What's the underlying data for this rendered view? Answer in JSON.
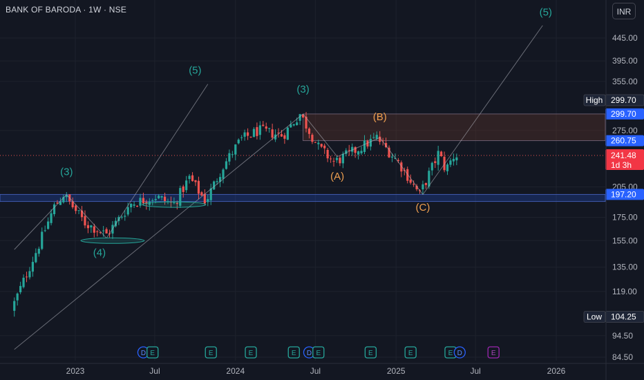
{
  "header": {
    "title": "BANK OF BARODA · 1W · NSE",
    "currency": "INR"
  },
  "colors": {
    "background": "#131722",
    "up": "#26a69a",
    "down": "#ef5350",
    "wave_teal": "#26a69a",
    "wave_orange": "#f0a050",
    "zone_blue": "#2962ff",
    "zone_brown": "#6d3a2a",
    "price_tag_red": "#f23645",
    "high_tag_blue": "#2962ff"
  },
  "chart_data": {
    "type": "candlestick",
    "title": "BANK OF BARODA · 1W · NSE",
    "x_axis": {
      "tick_labels": [
        "2023",
        "Jul",
        "2024",
        "Jul",
        "2025",
        "Jul",
        "2026"
      ]
    },
    "y_axis": {
      "scale": "log",
      "tick_labels": [
        "445.00",
        "395.00",
        "355.00",
        "275.00",
        "205.00",
        "175.00",
        "155.00",
        "135.00",
        "119.00",
        "94.50",
        "84.50"
      ],
      "range": [
        80,
        520
      ]
    },
    "price_tags": {
      "high_label": "High",
      "high_value": "299.70",
      "zone_top": "299.70",
      "zone_mid": "260.75",
      "last_price": "241.48",
      "countdown": "1d 3h",
      "zone_low": "197.20",
      "low_label": "Low",
      "low_value": "104.25"
    },
    "price_path": [
      {
        "date": "2022-08-15",
        "price": 108
      },
      {
        "date": "2022-10-15",
        "price": 150
      },
      {
        "date": "2022-11-21",
        "price": 185
      },
      {
        "date": "2022-12-12",
        "price": 197
      },
      {
        "date": "2023-01-30",
        "price": 170
      },
      {
        "date": "2023-03-20",
        "price": 160
      },
      {
        "date": "2023-05-15",
        "price": 188
      },
      {
        "date": "2023-07-10",
        "price": 195
      },
      {
        "date": "2023-08-20",
        "price": 187
      },
      {
        "date": "2023-09-25",
        "price": 215
      },
      {
        "date": "2023-11-01",
        "price": 190
      },
      {
        "date": "2023-12-10",
        "price": 228
      },
      {
        "date": "2024-01-20",
        "price": 262
      },
      {
        "date": "2024-03-01",
        "price": 275
      },
      {
        "date": "2024-04-25",
        "price": 268
      },
      {
        "date": "2024-06-03",
        "price": 299.7
      },
      {
        "date": "2024-07-15",
        "price": 252
      },
      {
        "date": "2024-08-20",
        "price": 233
      },
      {
        "date": "2024-10-20",
        "price": 252
      },
      {
        "date": "2024-11-25",
        "price": 265
      },
      {
        "date": "2025-01-15",
        "price": 232
      },
      {
        "date": "2025-03-03",
        "price": 197
      },
      {
        "date": "2025-04-15",
        "price": 245
      },
      {
        "date": "2025-05-01",
        "price": 224
      },
      {
        "date": "2025-05-20",
        "price": 241.48
      }
    ],
    "zones": [
      {
        "name": "upper-supply-zone",
        "low": 260.75,
        "high": 299.7,
        "color": "#6d3a2a"
      },
      {
        "name": "lower-demand-zone",
        "low": 190,
        "high": 197.2,
        "color": "#2962ff"
      }
    ],
    "wave_labels": [
      {
        "text": "(3)",
        "date": "2022-12-12",
        "price": 218,
        "color": "#26a69a"
      },
      {
        "text": "(4)",
        "date": "2023-02-25",
        "price": 143,
        "color": "#26a69a"
      },
      {
        "text": "(5)",
        "date": "2023-10-01",
        "price": 370,
        "color": "#26a69a"
      },
      {
        "text": "(3)",
        "date": "2024-06-03",
        "price": 335,
        "color": "#26a69a"
      },
      {
        "text": "(A)",
        "date": "2024-08-20",
        "price": 213,
        "color": "#f0a050"
      },
      {
        "text": "(B)",
        "date": "2024-11-25",
        "price": 290,
        "color": "#f0a050"
      },
      {
        "text": "(C)",
        "date": "2025-03-03",
        "price": 181,
        "color": "#f0a050"
      },
      {
        "text": "(5)",
        "date": "2025-12-08",
        "price": 500,
        "color": "#26a69a"
      }
    ],
    "trend_lines": [
      {
        "from": {
          "date": "2022-08-15",
          "price": 148
        },
        "to": {
          "date": "2022-12-12",
          "price": 197
        }
      },
      {
        "from": {
          "date": "2022-08-15",
          "price": 88
        },
        "to": {
          "date": "2024-06-03",
          "price": 299.7
        }
      },
      {
        "from": {
          "date": "2022-12-12",
          "price": 197
        },
        "to": {
          "date": "2023-03-13",
          "price": 157
        }
      },
      {
        "from": {
          "date": "2023-03-13",
          "price": 157
        },
        "to": {
          "date": "2023-10-30",
          "price": 350
        }
      },
      {
        "from": {
          "date": "2024-06-03",
          "price": 299.7
        },
        "to": {
          "date": "2024-08-20",
          "price": 240
        }
      },
      {
        "from": {
          "date": "2024-08-20",
          "price": 240
        },
        "to": {
          "date": "2024-11-25",
          "price": 265
        }
      },
      {
        "from": {
          "date": "2024-11-25",
          "price": 265
        },
        "to": {
          "date": "2025-03-03",
          "price": 197
        }
      },
      {
        "from": {
          "date": "2025-03-03",
          "price": 197
        },
        "to": {
          "date": "2025-12-01",
          "price": 475
        }
      }
    ],
    "support_ellipses": [
      {
        "date": "2023-03-27",
        "price": 155
      },
      {
        "date": "2023-08-14",
        "price": 187
      }
    ],
    "events": [
      {
        "text": "D",
        "date": "2023-06-05"
      },
      {
        "text": "E",
        "date": "2023-06-26"
      },
      {
        "text": "E",
        "date": "2023-11-06"
      },
      {
        "text": "E",
        "date": "2024-02-05"
      },
      {
        "text": "E",
        "date": "2024-05-13"
      },
      {
        "text": "D",
        "date": "2024-06-17"
      },
      {
        "text": "E",
        "date": "2024-07-08"
      },
      {
        "text": "E",
        "date": "2024-11-04"
      },
      {
        "text": "E",
        "date": "2025-02-03"
      },
      {
        "text": "E",
        "date": "2025-05-05"
      },
      {
        "text": "D",
        "date": "2025-05-26"
      },
      {
        "text": "E",
        "date": "2025-08-11"
      }
    ]
  }
}
